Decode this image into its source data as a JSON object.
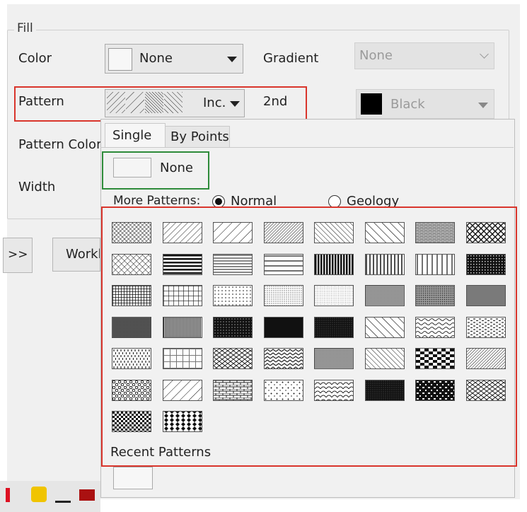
{
  "fill_section": {
    "title": "Fill",
    "color": {
      "label": "Color",
      "value": "None"
    },
    "gradient": {
      "label": "Gradient",
      "value": "None"
    },
    "pattern": {
      "label": "Pattern",
      "value": "Inc.",
      "second_label": "2nd"
    },
    "second_color": {
      "value": "Black",
      "swatch_color": "#000000"
    },
    "pattern_color": {
      "label": "Pattern Color"
    },
    "width": {
      "label": "Width"
    }
  },
  "background": {
    "nav_button": ">>",
    "workbook_button": "Workb"
  },
  "pattern_popup": {
    "tabs": [
      {
        "label": "Single"
      },
      {
        "label": "By Points"
      }
    ],
    "none_option": "None",
    "more_patterns_label": "More Patterns:",
    "radio_normal": {
      "label": "Normal",
      "checked": true
    },
    "radio_geology": {
      "label": "Geology",
      "checked": false
    },
    "recent_label": "Recent Patterns",
    "pattern_names": [
      "dense-diag-cross",
      "diag-lines",
      "diag-lines-wide",
      "dense-diag-right",
      "diag-left",
      "diag-left-wide",
      "brick-fine",
      "diamond-mesh",
      "cross-hatch",
      "horizontal-bold",
      "horizontal-lines",
      "horizontal-wide",
      "vertical-bold",
      "vertical-lines",
      "vertical-wide",
      "dark-grid",
      "grid-bold",
      "grid-lines",
      "dots-sparse",
      "dots-fine",
      "dots-light",
      "gray-medium",
      "gray-dots",
      "gray-solid",
      "gray-dark",
      "vertical-dense",
      "black-dots",
      "black-grid",
      "black-fine",
      "wave-diag",
      "wave-horizontal",
      "dash-small",
      "dash-vertical",
      "grid-wide",
      "herring",
      "zigzag",
      "weave-light",
      "dots-diag",
      "checker-bars",
      "weave-diag",
      "pebbles",
      "brick-diag",
      "brick-horizontal",
      "stars",
      "scales",
      "dense-black",
      "blocks-mixed",
      "spiral",
      "checker-small",
      "flags"
    ]
  },
  "colors": {
    "red_highlight": "#d9352c",
    "green_highlight": "#2e8b3a",
    "curve_blue": "#1f2fd6"
  }
}
